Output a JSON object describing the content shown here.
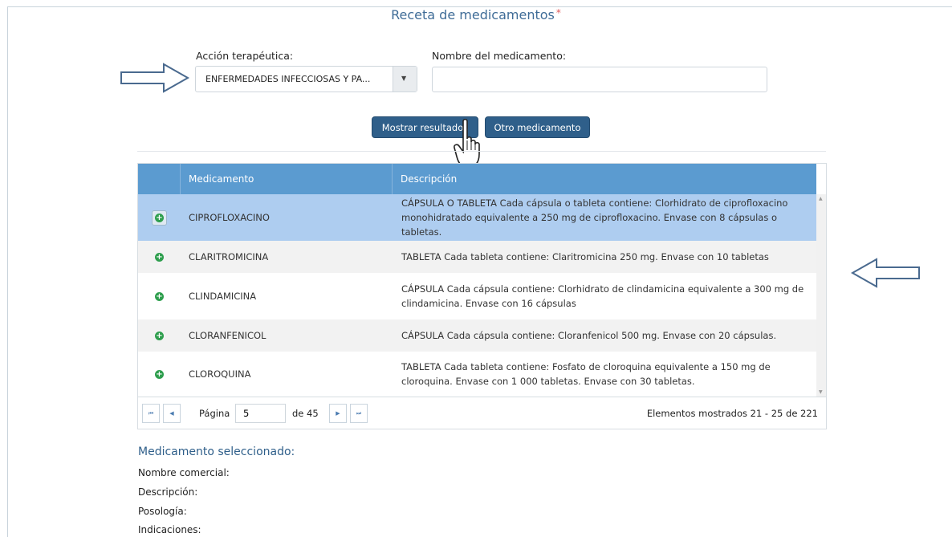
{
  "title": "Receta de medicamentos",
  "required_mark": "*",
  "filters": {
    "accion_label": "Acción terapéutica:",
    "accion_value": "ENFERMEDADES INFECCIOSAS Y PA...",
    "nombre_label": "Nombre del medicamento:",
    "nombre_value": ""
  },
  "buttons": {
    "mostrar": "Mostrar resultados",
    "otro": "Otro medicamento"
  },
  "table": {
    "columns": [
      "Medicamento",
      "Descripción"
    ],
    "rows": [
      {
        "name": "CIPROFLOXACINO",
        "desc": "CÁPSULA O TABLETA Cada cápsula o tableta contiene: Clorhidrato de ciprofloxacino monohidratado equivalente a 250 mg de ciprofloxacino. Envase con 8 cápsulas o tabletas.",
        "selected": true
      },
      {
        "name": "CLARITROMICINA",
        "desc": "TABLETA Cada tableta contiene: Claritromicina 250 mg. Envase con 10 tabletas"
      },
      {
        "name": "CLINDAMICINA",
        "desc": "CÁPSULA Cada cápsula contiene: Clorhidrato de clindamicina equivalente a 300 mg de clindamicina. Envase con 16 cápsulas"
      },
      {
        "name": "CLORANFENICOL",
        "desc": "CÁPSULA Cada cápsula contiene: Cloranfenicol 500 mg. Envase con 20 cápsulas."
      },
      {
        "name": "CLOROQUINA",
        "desc": "TABLETA Cada tableta contiene: Fosfato de cloroquina equivalente a 150 mg de cloroquina. Envase con 1 000 tabletas. Envase con 30 tabletas."
      }
    ]
  },
  "pager": {
    "page_label": "Página",
    "page_value": "5",
    "of_label": "de 45",
    "info": "Elementos mostrados 21 - 25 de 221"
  },
  "selected": {
    "title": "Medicamento seleccionado:",
    "nombre_comercial": "Nombre comercial:",
    "descripcion": "Descripción:",
    "posologia": "Posología:",
    "indicaciones": "Indicaciones:"
  },
  "colors": {
    "header": "#5b9bd0",
    "selected_row": "#aecdf0",
    "button": "#2f5f8a"
  }
}
